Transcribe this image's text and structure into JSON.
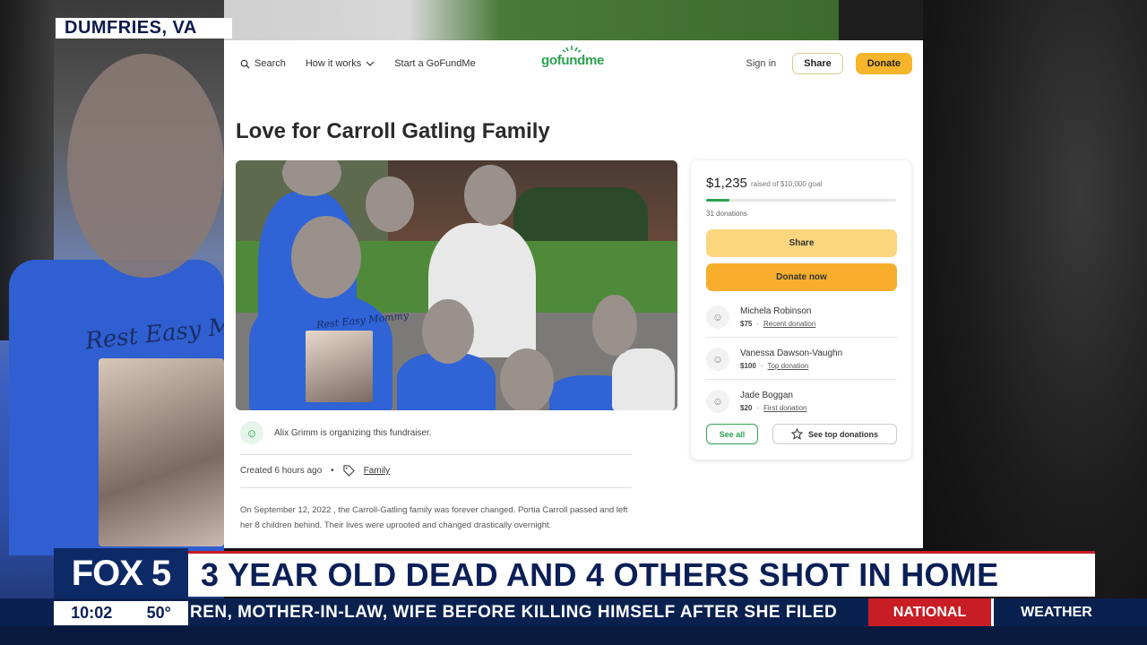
{
  "location": "DUMFRIES, VA",
  "bg_print": "Rest Easy M",
  "nav": {
    "search": "Search",
    "how_it_works": "How it works",
    "start": "Start a GoFundMe",
    "logo": "gofundme",
    "signin": "Sign in",
    "share": "Share",
    "donate": "Donate"
  },
  "campaign": {
    "title": "Love for Carroll Gatling Family",
    "photo_print": "Rest Easy Mommy",
    "organizer": "Alix Grimm is organizing this fundraiser.",
    "created": "Created 6 hours ago",
    "category": "Family",
    "story": "On September 12, 2022 , the Carroll-Gatling family was forever changed. Portia Carroll passed and left her 8 children behind. Their lives were uprooted and changed drastically overnight."
  },
  "card": {
    "raised": "$1,235",
    "goal_text": "raised of $10,000 goal",
    "progress": 0.1235,
    "donations": "31 donations",
    "share_btn": "Share",
    "donate_btn": "Donate now",
    "donors": [
      {
        "name": "Michela Robinson",
        "amount": "$75",
        "tag": "Recent donation"
      },
      {
        "name": "Vanessa Dawson-Vaughn",
        "amount": "$100",
        "tag": "Top donation"
      },
      {
        "name": "Jade Boggan",
        "amount": "$20",
        "tag": "First donation"
      }
    ],
    "see_all": "See all",
    "see_top": "See top donations"
  },
  "broadcast": {
    "logo": "FOX 5",
    "headline": "3 YEAR OLD DEAD AND 4 OTHERS SHOT IN HOME",
    "time": "10:02",
    "temp": "50°",
    "crawl": "REN, MOTHER-IN-LAW, WIFE BEFORE KILLING HIMSELF AFTER SHE FILED",
    "tab1": "NATIONAL",
    "tab2": "WEATHER"
  },
  "colors": {
    "brand_green": "#2aa350",
    "donate_orange": "#f7ae2c",
    "fox_navy": "#0b1f57",
    "fox_red": "#c81d25"
  }
}
